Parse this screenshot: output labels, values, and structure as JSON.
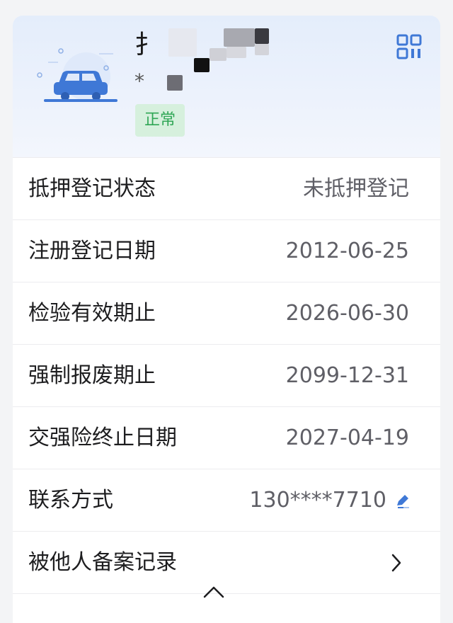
{
  "vehicle": {
    "plate_visible": "扌",
    "sub_visible": "*",
    "status": "正常"
  },
  "rows": [
    {
      "label": "抵押登记状态",
      "value": "未抵押登记"
    },
    {
      "label": "注册登记日期",
      "value": "2012-06-25"
    },
    {
      "label": "检验有效期止",
      "value": "2026-06-30"
    },
    {
      "label": "强制报废期止",
      "value": "2099-12-31"
    },
    {
      "label": "交强险终止日期",
      "value": "2027-04-19"
    },
    {
      "label": "联系方式",
      "value": "130****7710"
    },
    {
      "label": "被他人备案记录",
      "value": ""
    }
  ],
  "icons": {
    "qr": "qr-code-icon",
    "edit": "edit-icon",
    "chevron": "chevron-right-icon",
    "collapse": "chevron-up-icon",
    "car": "car-icon"
  },
  "colors": {
    "status_bg": "#d6f0dd",
    "status_text": "#2fa655",
    "accent_blue": "#3f78d6"
  }
}
